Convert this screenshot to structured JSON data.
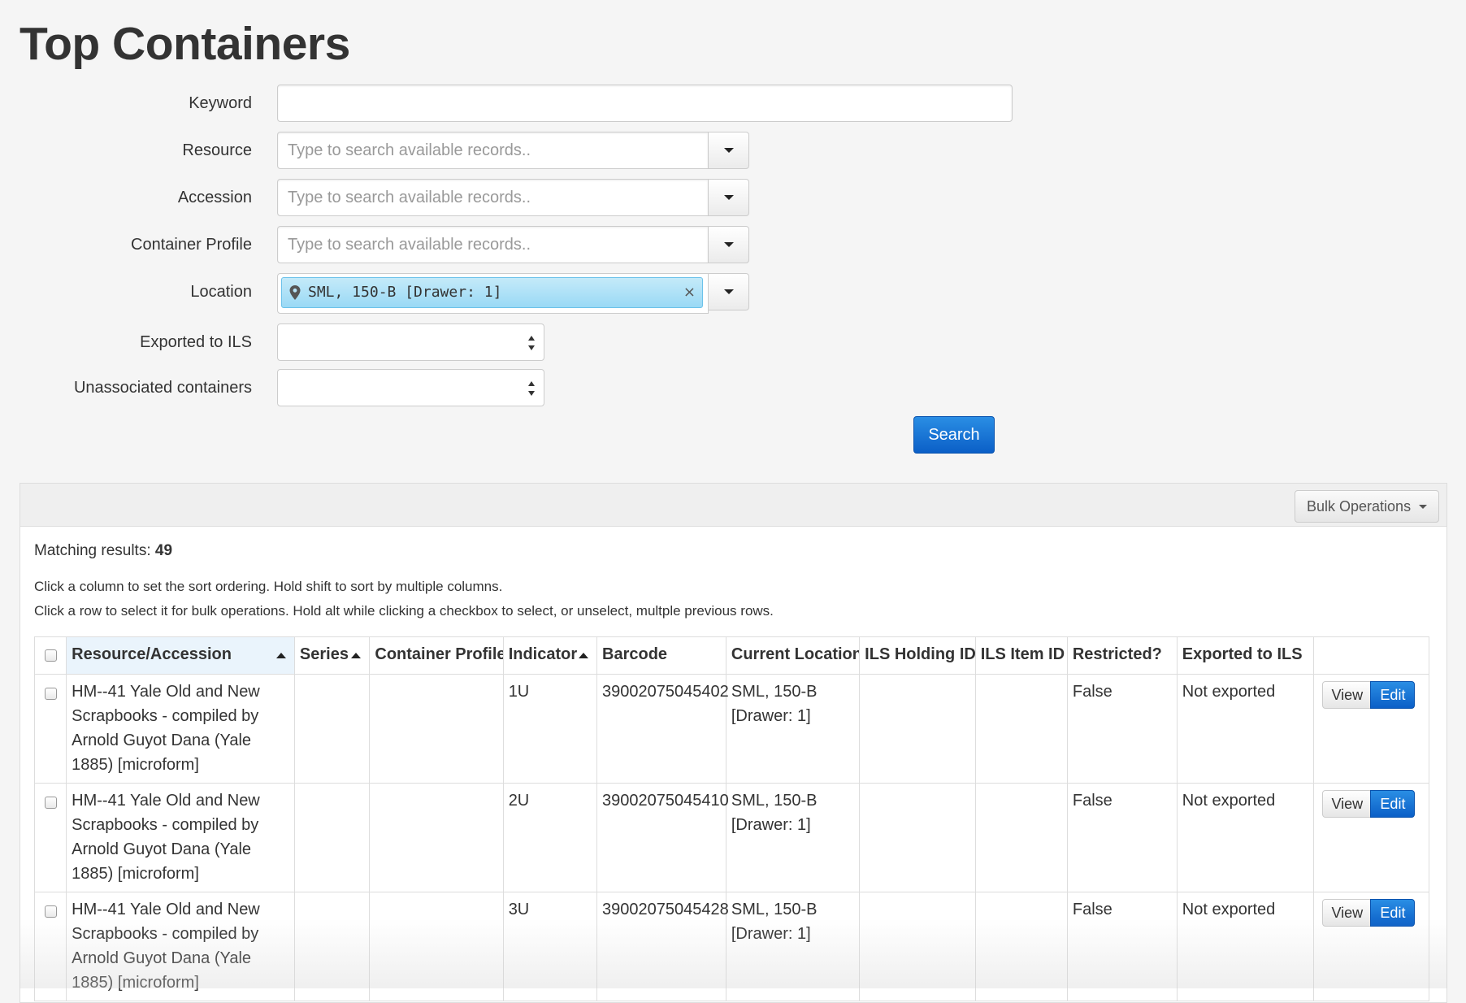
{
  "page": {
    "title": "Top Containers"
  },
  "search_form": {
    "keyword": {
      "label": "Keyword",
      "value": ""
    },
    "resource": {
      "label": "Resource",
      "placeholder": "Type to search available records.."
    },
    "accession": {
      "label": "Accession",
      "placeholder": "Type to search available records.."
    },
    "container_profile": {
      "label": "Container Profile",
      "placeholder": "Type to search available records.."
    },
    "location": {
      "label": "Location",
      "token": "SML, 150-B [Drawer: 1]",
      "remove_glyph": "×"
    },
    "exported_to_ils": {
      "label": "Exported to ILS",
      "value": ""
    },
    "unassociated_containers": {
      "label": "Unassociated containers",
      "value": ""
    },
    "search_button": "Search"
  },
  "results": {
    "bulk_operations_label": "Bulk Operations",
    "matching_label": "Matching results:",
    "matching_count": "49",
    "hint_sort": "Click a column to set the sort ordering. Hold shift to sort by multiple columns.",
    "hint_select": "Click a row to select it for bulk operations. Hold alt while clicking a checkbox to select, or unselect, multple previous rows.",
    "columns": [
      {
        "label": "Resource/Accession",
        "sorted": true
      },
      {
        "label": "Series",
        "sorted": true
      },
      {
        "label": "Container Profile",
        "sorted": false
      },
      {
        "label": "Indicator",
        "sorted": true
      },
      {
        "label": "Barcode",
        "sorted": false
      },
      {
        "label": "Current Location",
        "sorted": false
      },
      {
        "label": "ILS Holding ID",
        "sorted": false
      },
      {
        "label": "ILS Item ID",
        "sorted": false
      },
      {
        "label": "Restricted?",
        "sorted": false
      },
      {
        "label": "Exported to ILS",
        "sorted": false
      }
    ],
    "rows": [
      {
        "resource": "HM--41 Yale Old and New Scrapbooks - compiled by Arnold Guyot Dana (Yale 1885) [microform]",
        "series": "",
        "container_profile": "",
        "indicator": "1U",
        "barcode": "39002075045402",
        "location_line1": "SML, 150-B",
        "location_line2": "[Drawer: 1]",
        "ils_holding_id": "",
        "ils_item_id": "",
        "restricted": "False",
        "exported": "Not exported",
        "view_label": "View",
        "edit_label": "Edit"
      },
      {
        "resource": "HM--41 Yale Old and New Scrapbooks - compiled by Arnold Guyot Dana (Yale 1885) [microform]",
        "series": "",
        "container_profile": "",
        "indicator": "2U",
        "barcode": "39002075045410",
        "location_line1": "SML, 150-B",
        "location_line2": "[Drawer: 1]",
        "ils_holding_id": "",
        "ils_item_id": "",
        "restricted": "False",
        "exported": "Not exported",
        "view_label": "View",
        "edit_label": "Edit"
      },
      {
        "resource": "HM--41 Yale Old and New Scrapbooks - compiled by Arnold Guyot Dana (Yale 1885) [microform]",
        "series": "",
        "container_profile": "",
        "indicator": "3U",
        "barcode": "39002075045428",
        "location_line1": "SML, 150-B",
        "location_line2": "[Drawer: 1]",
        "ils_holding_id": "",
        "ils_item_id": "",
        "restricted": "False",
        "exported": "Not exported",
        "view_label": "View",
        "edit_label": "Edit"
      }
    ]
  }
}
